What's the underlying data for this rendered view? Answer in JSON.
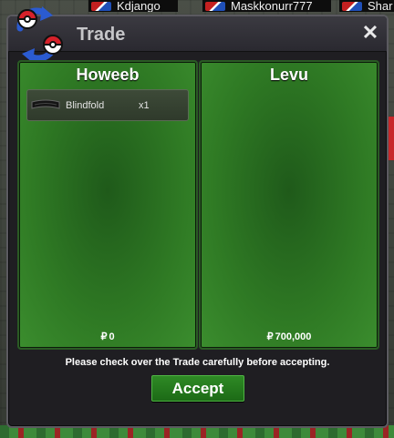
{
  "background": {
    "players": [
      "Kdjango",
      "Maskkonurr777",
      "Shar"
    ]
  },
  "window": {
    "title": "Trade",
    "close_label": "✕",
    "accent_green": "#2f7a24",
    "button_green": "#1c6a16"
  },
  "trade": {
    "left": {
      "name": "Howeeb",
      "items": [
        {
          "name": "Blindfold",
          "qty": "x1",
          "icon": "blindfold-icon"
        }
      ],
      "currency_symbol": "₽",
      "money": "0"
    },
    "right": {
      "name": "Levu",
      "items": [],
      "currency_symbol": "₽",
      "money": "700,000"
    }
  },
  "footer": {
    "notice": "Please check over the Trade carefully before accepting.",
    "accept_label": "Accept"
  }
}
